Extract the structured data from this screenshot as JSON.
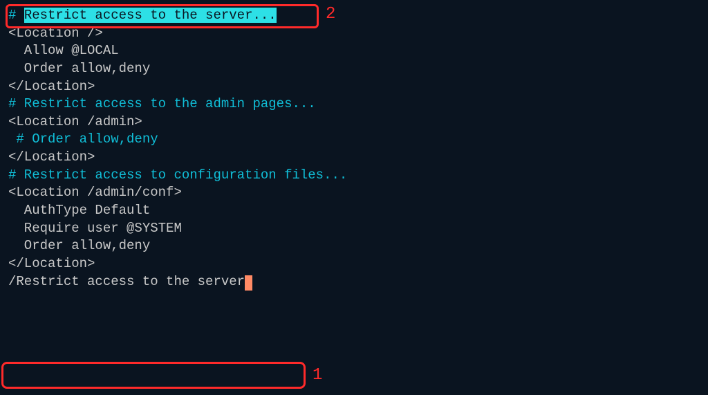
{
  "editor": {
    "line1_hash": "# ",
    "line1_highlighted": "Restrict access to the server...",
    "line2": "<Location />",
    "line3": "  Allow @LOCAL",
    "line4": "  Order allow,deny",
    "line5": "</Location>",
    "line6": "",
    "line7": "# Restrict access to the admin pages...",
    "line8": "<Location /admin>",
    "line9": " # Order allow,deny",
    "line10": "</Location>",
    "line11": "",
    "line12": "# Restrict access to configuration files...",
    "line13": "<Location /admin/conf>",
    "line14": "  AuthType Default",
    "line15": "  Require user @SYSTEM",
    "line16": "  Order allow,deny",
    "line17": "</Location>",
    "line18": "",
    "search_prefix": "/",
    "search_text": "Restrict access to the server"
  },
  "annotations": {
    "label1": "1",
    "label2": "2"
  }
}
